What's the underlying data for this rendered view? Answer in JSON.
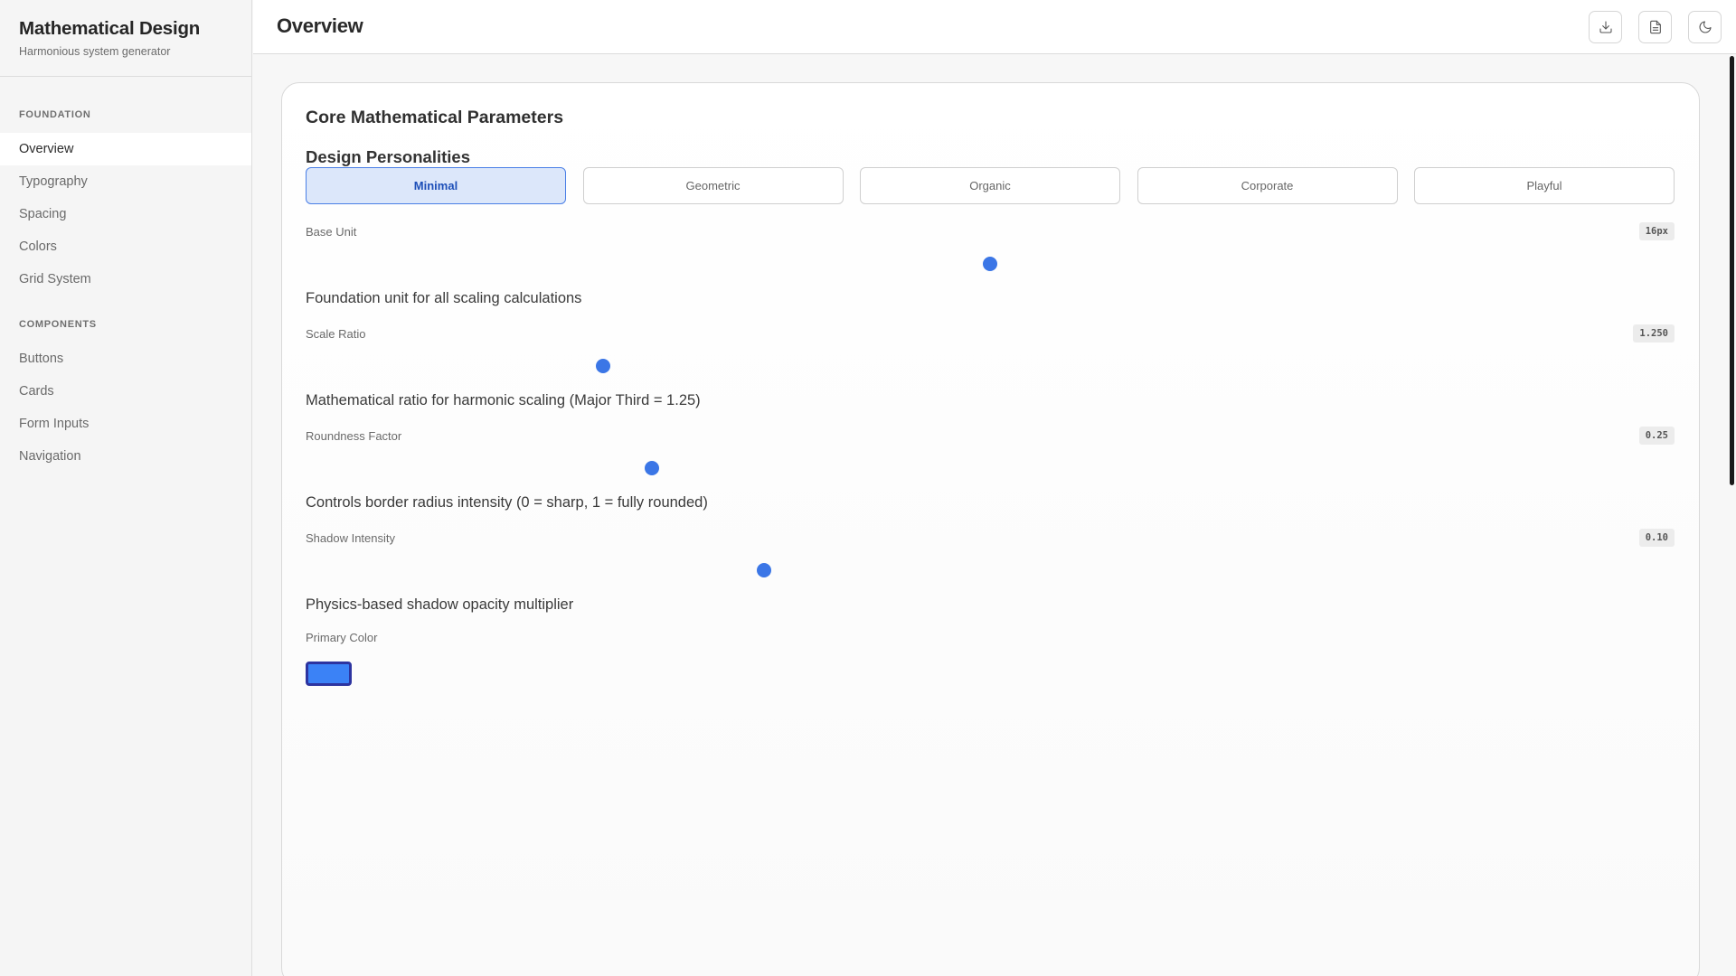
{
  "sidebar": {
    "title": "Mathematical Design",
    "subtitle": "Harmonious system generator",
    "sections": [
      {
        "label": "FOUNDATION",
        "items": [
          {
            "label": "Overview"
          },
          {
            "label": "Typography"
          },
          {
            "label": "Spacing"
          },
          {
            "label": "Colors"
          },
          {
            "label": "Grid System"
          }
        ]
      },
      {
        "label": "COMPONENTS",
        "items": [
          {
            "label": "Buttons"
          },
          {
            "label": "Cards"
          },
          {
            "label": "Form Inputs"
          },
          {
            "label": "Navigation"
          }
        ]
      }
    ],
    "active_item": "Overview"
  },
  "header": {
    "title": "Overview",
    "icons": [
      "download-icon",
      "document-icon",
      "moon-icon"
    ]
  },
  "main": {
    "card_title": "Core Mathematical Parameters",
    "personalities_title": "Design Personalities",
    "personalities": [
      {
        "label": "Minimal",
        "active": true
      },
      {
        "label": "Geometric",
        "active": false
      },
      {
        "label": "Organic",
        "active": false
      },
      {
        "label": "Corporate",
        "active": false
      },
      {
        "label": "Playful",
        "active": false
      }
    ],
    "parameters": [
      {
        "label": "Base Unit",
        "value": "16px",
        "slider_fraction": 0.5,
        "description": "Foundation unit for all scaling calculations"
      },
      {
        "label": "Scale Ratio",
        "value": "1.250",
        "slider_fraction": 0.217,
        "description": "Mathematical ratio for harmonic scaling (Major Third = 1.25)"
      },
      {
        "label": "Roundness Factor",
        "value": "0.25",
        "slider_fraction": 0.253,
        "description": "Controls border radius intensity (0 = sharp, 1 = fully rounded)"
      },
      {
        "label": "Shadow Intensity",
        "value": "0.10",
        "slider_fraction": 0.335,
        "description": "Physics-based shadow opacity multiplier"
      }
    ],
    "primary_color_label": "Primary Color",
    "primary_color": "#3b82f6"
  },
  "colors": {
    "accent": "#3b76e6",
    "active_bg": "#dce7fa",
    "active_text": "#1d4fb8"
  }
}
